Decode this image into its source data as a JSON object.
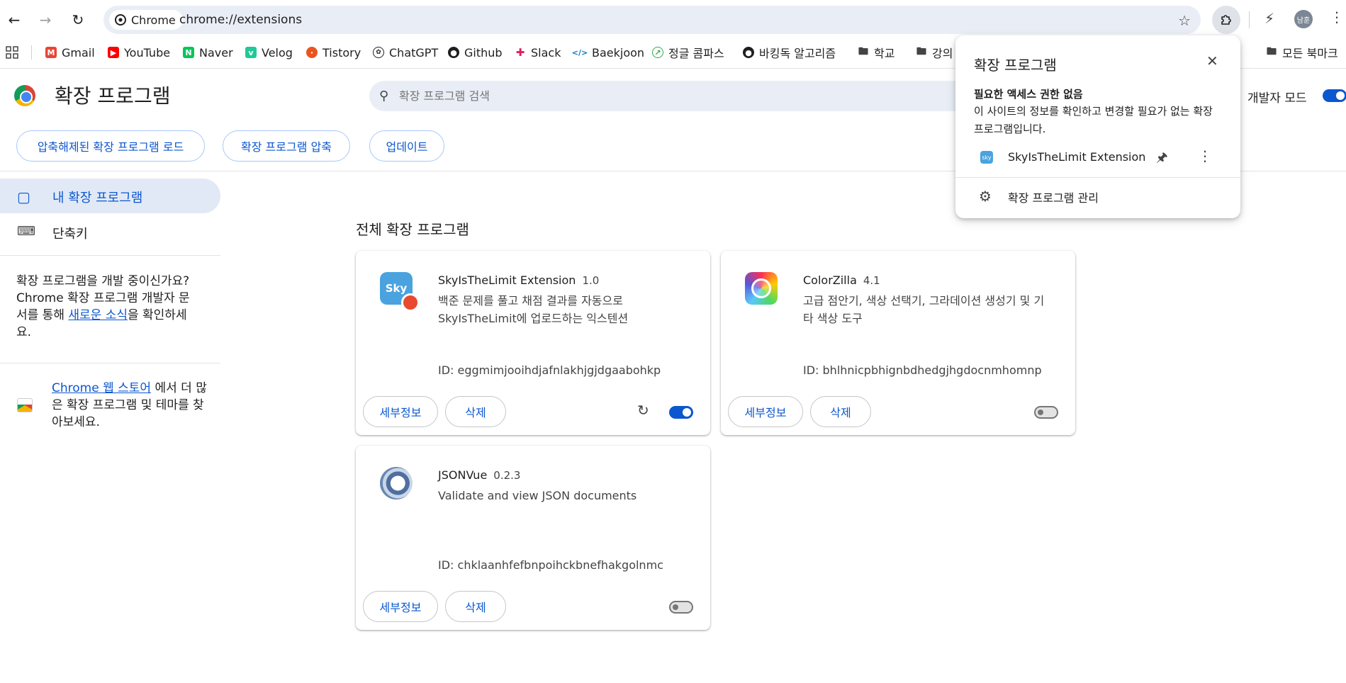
{
  "browser": {
    "chip_label": "Chrome",
    "url": "chrome://extensions",
    "avatar_text": "남훈"
  },
  "bookmarks": [
    {
      "label": "Gmail",
      "icon": "gmail-icon",
      "color": "#ea4335"
    },
    {
      "label": "YouTube",
      "icon": "youtube-icon",
      "color": "#ff0000"
    },
    {
      "label": "Naver",
      "icon": "naver-icon",
      "color": "#03c75a"
    },
    {
      "label": "Velog",
      "icon": "velog-icon",
      "color": "#20c997"
    },
    {
      "label": "Tistory",
      "icon": "tistory-icon",
      "color": "#eb531f"
    },
    {
      "label": "ChatGPT",
      "icon": "chatgpt-icon",
      "color": "#1f1f1f"
    },
    {
      "label": "Github",
      "icon": "github-icon",
      "color": "#1f1f1f"
    },
    {
      "label": "Slack",
      "icon": "slack-icon",
      "color": "#4a154b"
    },
    {
      "label": "Baekjoon",
      "icon": "code-icon",
      "color": "#0076c0"
    },
    {
      "label": "정글 콤파스",
      "icon": "compass-icon",
      "color": "#34a853"
    },
    {
      "label": "바킹독 알고리즘",
      "icon": "github-icon",
      "color": "#1f1f1f"
    },
    {
      "label": "학교",
      "icon": "folder-icon",
      "color": "#444746"
    },
    {
      "label": "강의",
      "icon": "folder-icon",
      "color": "#444746"
    }
  ],
  "bookmarks_all": "모든 북마크",
  "header": {
    "title": "확장 프로그램",
    "search_placeholder": "확장 프로그램 검색",
    "dev_mode_label": "개발자 모드",
    "dev_mode_on": true
  },
  "toolbar": {
    "load_unpacked": "압축해제된 확장 프로그램 로드",
    "pack": "확장 프로그램 압축",
    "update": "업데이트"
  },
  "sidebar": {
    "my_extensions": "내 확장 프로그램",
    "shortcuts": "단축키",
    "dev_note_1": "확장 프로그램을 개발 중이신가요? Chrome 확장 프로그램 개발자 문서를 통해 ",
    "dev_note_link": "새로운 소식",
    "dev_note_2": "을 확인하세요.",
    "store_link": "Chrome 웹 스토어",
    "store_note": " 에서 더 많은 확장 프로그램 및 테마를 찾아보세요."
  },
  "section_title": "전체 확장 프로그램",
  "extensions": [
    {
      "name": "SkyIsTheLimit Extension",
      "version": "1.0",
      "description": "백준 문제를 풀고 채점 결과를 자동으로 SkyIsTheLimit에 업로드하는 익스텐션",
      "id": "ID: eggmimjooihdjafnlakhjgjdgaabohkp",
      "details_label": "세부정보",
      "remove_label": "삭제",
      "enabled": true,
      "icon_text": "Sky"
    },
    {
      "name": "ColorZilla",
      "version": "4.1",
      "description": "고급 점안기, 색상 선택기, 그라데이션 생성기 및 기타 색상 도구",
      "id": "ID: bhlhnicpbhignbdhedgjhgdocnmhomnp",
      "details_label": "세부정보",
      "remove_label": "삭제",
      "enabled": false
    },
    {
      "name": "JSONVue",
      "version": "0.2.3",
      "description": "Validate and view JSON documents",
      "id": "ID: chklaanhfefbnpoihckbnefhakgolnmc",
      "details_label": "세부정보",
      "remove_label": "삭제",
      "enabled": false
    }
  ],
  "popup": {
    "title": "확장 프로그램",
    "subtitle": "필요한 액세스 권한 없음",
    "description": "이 사이트의 정보를 확인하고 변경할 필요가 없는 확장 프로그램입니다.",
    "extension_name": "SkyIsTheLimit Extension",
    "extension_icon_text": "sky",
    "manage_label": "확장 프로그램 관리"
  },
  "colors": {
    "accent": "#0b57d0",
    "omnibox_bg": "#e9eef6",
    "nav_selected_bg": "#e1e9f6"
  }
}
